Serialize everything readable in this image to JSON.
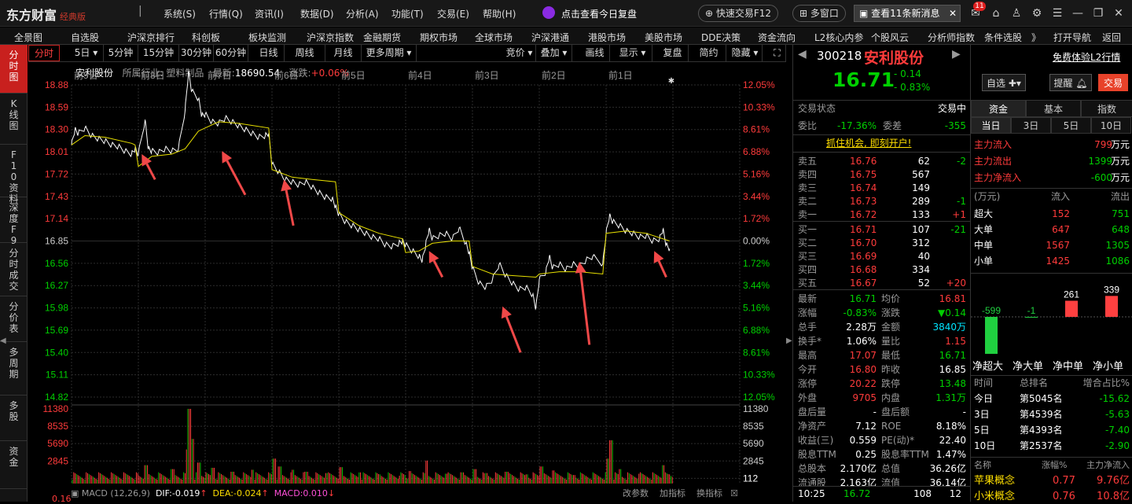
{
  "app": {
    "name": "东方财富",
    "edition": "经典版"
  },
  "top_menu": [
    "系统(S)",
    "行情(Q)",
    "资讯(I)",
    "数据(D)",
    "分析(A)",
    "功能(T)",
    "交易(E)",
    "帮助(H)"
  ],
  "top_actions": {
    "review": "点击查看今日复盘",
    "quick_trade": "快速交易F12",
    "multi_window": "多窗口",
    "messages": "查看11条新消息",
    "badge": "11"
  },
  "nav": [
    "全景图",
    "自选股",
    "沪深京排行",
    "科创板",
    "板块监测",
    "沪深京指数",
    "金融期货",
    "期权市场",
    "全球市场",
    "沪深港通",
    "港股市场",
    "美股市场",
    "DDE决策",
    "资金流向",
    "L2核心内参",
    "个股风云",
    "分析师指数",
    "条件选股",
    "》",
    "打开导航",
    "返回"
  ],
  "sidebar": [
    "分时图",
    "K线图",
    "F10资料",
    "深度F9",
    "分时成交",
    "分价表",
    "多周期",
    "多股",
    "资金"
  ],
  "toolbar": {
    "left": [
      "分时",
      "5日",
      "5分钟",
      "15分钟",
      "30分钟",
      "60分钟",
      "日线",
      "周线",
      "月线",
      "更多周期"
    ],
    "right": [
      "竞价",
      "叠加",
      "画线",
      "显示",
      "复盘",
      "简约",
      "隐藏"
    ]
  },
  "chart_header": {
    "name": "安利股份",
    "industry": "所属行业: 塑料制品",
    "latest_label": "最新:",
    "latest": "18690.54",
    "change_label": "涨跌:",
    "change": "+0.06%"
  },
  "chart_data": {
    "type": "line",
    "days": [
      "前9日",
      "前8日",
      "前7日",
      "前6日",
      "前5日",
      "前4日",
      "前3日",
      "前2日",
      "前1日",
      ""
    ],
    "price_ticks": [
      "18.88",
      "18.59",
      "18.30",
      "18.01",
      "17.72",
      "17.43",
      "17.14",
      "16.85",
      "16.56",
      "16.27",
      "15.98",
      "15.69",
      "15.40",
      "15.11",
      "14.82"
    ],
    "pct_ticks": [
      "12.05%",
      "10.33%",
      "8.61%",
      "6.88%",
      "5.16%",
      "3.44%",
      "1.72%",
      "0.00%",
      "1.72%",
      "3.44%",
      "5.16%",
      "6.88%",
      "8.61%",
      "10.33%",
      "12.05%"
    ],
    "vol_ticks": [
      "11380",
      "8535",
      "5690",
      "2845"
    ],
    "vol_right": [
      "11380",
      "8535",
      "5690",
      "2845",
      "112"
    ],
    "ylim": [
      14.82,
      18.88
    ],
    "price": [
      [
        0,
        18.1
      ],
      [
        0.05,
        18.3
      ],
      [
        0.1,
        18.25
      ],
      [
        0.2,
        18.32
      ],
      [
        0.3,
        18.22
      ],
      [
        0.4,
        18.18
      ],
      [
        0.5,
        18.15
      ],
      [
        0.6,
        18.1
      ],
      [
        0.7,
        18.08
      ],
      [
        0.8,
        18.02
      ],
      [
        0.9,
        17.98
      ],
      [
        0.95,
        18.05
      ],
      [
        1.0,
        17.98
      ],
      [
        1.1,
        18.42
      ],
      [
        1.15,
        18.05
      ],
      [
        1.2,
        18.02
      ],
      [
        1.3,
        18.0
      ],
      [
        1.4,
        18.05
      ],
      [
        1.5,
        18.02
      ],
      [
        1.6,
        18.05
      ],
      [
        1.7,
        18.55
      ],
      [
        1.75,
        19.05
      ],
      [
        1.8,
        18.8
      ],
      [
        1.9,
        18.7
      ],
      [
        1.95,
        18.48
      ],
      [
        2.0,
        18.5
      ],
      [
        2.1,
        18.4
      ],
      [
        2.2,
        18.38
      ],
      [
        2.3,
        18.45
      ],
      [
        2.4,
        18.4
      ],
      [
        2.5,
        18.35
      ],
      [
        2.6,
        18.3
      ],
      [
        2.7,
        18.25
      ],
      [
        2.8,
        18.2
      ],
      [
        2.9,
        18.22
      ],
      [
        2.95,
        18.25
      ],
      [
        3.0,
        17.85
      ],
      [
        3.1,
        17.75
      ],
      [
        3.2,
        17.65
      ],
      [
        3.3,
        17.62
      ],
      [
        3.4,
        17.58
      ],
      [
        3.5,
        17.62
      ],
      [
        3.6,
        17.55
      ],
      [
        3.7,
        17.48
      ],
      [
        3.8,
        17.42
      ],
      [
        3.9,
        17.4
      ],
      [
        3.95,
        17.3
      ],
      [
        4.0,
        17.2
      ],
      [
        4.1,
        17.1
      ],
      [
        4.2,
        17.05
      ],
      [
        4.3,
        17.0
      ],
      [
        4.4,
        16.95
      ],
      [
        4.5,
        16.9
      ],
      [
        4.6,
        16.88
      ],
      [
        4.7,
        16.8
      ],
      [
        4.8,
        16.78
      ],
      [
        4.9,
        16.82
      ],
      [
        4.95,
        16.85
      ],
      [
        5.0,
        16.8
      ],
      [
        5.1,
        16.72
      ],
      [
        5.2,
        16.65
      ],
      [
        5.25,
        16.6
      ],
      [
        5.3,
        16.8
      ],
      [
        5.35,
        17.0
      ],
      [
        5.4,
        16.88
      ],
      [
        5.5,
        16.92
      ],
      [
        5.6,
        16.95
      ],
      [
        5.7,
        16.88
      ],
      [
        5.8,
        17.02
      ],
      [
        5.9,
        16.82
      ],
      [
        5.95,
        16.7
      ],
      [
        6.0,
        16.5
      ],
      [
        6.1,
        16.3
      ],
      [
        6.2,
        16.25
      ],
      [
        6.3,
        16.35
      ],
      [
        6.4,
        16.55
      ],
      [
        6.5,
        16.4
      ],
      [
        6.6,
        16.3
      ],
      [
        6.7,
        16.22
      ],
      [
        6.8,
        16.25
      ],
      [
        6.9,
        16.15
      ],
      [
        6.95,
        15.98
      ],
      [
        7.0,
        16.35
      ],
      [
        7.1,
        16.45
      ],
      [
        7.15,
        16.65
      ],
      [
        7.2,
        16.5
      ],
      [
        7.3,
        16.55
      ],
      [
        7.4,
        16.48
      ],
      [
        7.5,
        16.55
      ],
      [
        7.6,
        16.52
      ],
      [
        7.7,
        16.6
      ],
      [
        7.8,
        16.65
      ],
      [
        7.95,
        16.55
      ],
      [
        8.0,
        16.95
      ],
      [
        8.05,
        17.18
      ],
      [
        8.1,
        17.1
      ],
      [
        8.2,
        17.05
      ],
      [
        8.3,
        16.98
      ],
      [
        8.4,
        16.95
      ],
      [
        8.5,
        16.9
      ],
      [
        8.6,
        16.92
      ],
      [
        8.7,
        16.85
      ],
      [
        8.8,
        16.88
      ],
      [
        8.85,
        17.0
      ],
      [
        8.9,
        16.8
      ],
      [
        8.95,
        16.75
      ]
    ],
    "avg": [
      [
        0,
        18.1
      ],
      [
        0.2,
        18.22
      ],
      [
        0.5,
        18.2
      ],
      [
        0.9,
        18.12
      ],
      [
        0.95,
        18.1
      ],
      [
        1.0,
        17.82
      ],
      [
        1.2,
        17.95
      ],
      [
        1.5,
        17.98
      ],
      [
        1.7,
        18.05
      ],
      [
        1.9,
        18.28
      ],
      [
        2.2,
        18.4
      ],
      [
        2.5,
        18.38
      ],
      [
        2.95,
        18.32
      ],
      [
        3.0,
        17.78
      ],
      [
        3.3,
        17.68
      ],
      [
        3.6,
        17.65
      ],
      [
        3.95,
        17.62
      ],
      [
        4.0,
        17.22
      ],
      [
        4.3,
        17.05
      ],
      [
        4.6,
        16.95
      ],
      [
        4.95,
        16.88
      ],
      [
        5.0,
        16.7
      ],
      [
        5.2,
        16.72
      ],
      [
        5.4,
        16.82
      ],
      [
        5.7,
        16.85
      ],
      [
        5.95,
        16.85
      ],
      [
        6.0,
        16.52
      ],
      [
        6.3,
        16.42
      ],
      [
        6.6,
        16.4
      ],
      [
        6.95,
        16.38
      ],
      [
        7.0,
        16.42
      ],
      [
        7.3,
        16.45
      ],
      [
        7.6,
        16.45
      ],
      [
        7.95,
        16.42
      ],
      [
        8.0,
        16.95
      ],
      [
        8.3,
        16.98
      ],
      [
        8.6,
        16.95
      ],
      [
        8.95,
        16.85
      ]
    ],
    "volume": [
      [
        0.05,
        1200
      ],
      [
        0.3,
        900
      ],
      [
        0.6,
        1100
      ],
      [
        1.1,
        2800
      ],
      [
        1.3,
        1500
      ],
      [
        1.5,
        2200
      ],
      [
        1.72,
        5200
      ],
      [
        1.75,
        11380
      ],
      [
        1.8,
        6800
      ],
      [
        1.9,
        3200
      ],
      [
        2.1,
        2400
      ],
      [
        2.4,
        1800
      ],
      [
        2.7,
        2100
      ],
      [
        3.02,
        3800
      ],
      [
        3.1,
        2600
      ],
      [
        3.3,
        2100
      ],
      [
        3.5,
        1800
      ],
      [
        3.8,
        1600
      ],
      [
        4.02,
        2500
      ],
      [
        4.3,
        1700
      ],
      [
        4.6,
        1400
      ],
      [
        4.9,
        1200
      ],
      [
        5.05,
        1900
      ],
      [
        5.3,
        3500
      ],
      [
        5.6,
        1500
      ],
      [
        5.85,
        1700
      ],
      [
        6.02,
        2200
      ],
      [
        6.2,
        1600
      ],
      [
        6.5,
        1800
      ],
      [
        6.8,
        1400
      ],
      [
        7.02,
        2600
      ],
      [
        7.2,
        2000
      ],
      [
        7.5,
        1300
      ],
      [
        7.8,
        1100
      ],
      [
        8.02,
        3800
      ],
      [
        8.06,
        6600
      ],
      [
        8.2,
        2200
      ],
      [
        8.5,
        1500
      ],
      [
        8.85,
        2800
      ],
      [
        8.92,
        1400
      ]
    ],
    "annotations": "red arrows"
  },
  "macd": {
    "name": "MACD (12,26,9)",
    "dif_label": "DIF:",
    "dif": "-0.019",
    "dea_label": "DEA:",
    "dea": "-0.024",
    "macd_label": "MACD:",
    "macd": "0.010",
    "low_tick": "0.16",
    "actions": [
      "改参数",
      "加指标",
      "换指标"
    ]
  },
  "quote": {
    "code": "300218",
    "name": "安利股份",
    "price": "16.71",
    "change": "- 0.14",
    "change_pct": "- 0.83%",
    "l2_link": "免费体验L2行情",
    "btn_watch": "自选",
    "btn_alert": "提醒",
    "btn_trade": "交易",
    "trade_status_label": "交易状态",
    "trade_status": "交易中",
    "weibi_label": "委比",
    "weibi": "-17.36%",
    "weicha_label": "委差",
    "weicha": "-355",
    "promo": "抓住机会, 即刻开户!",
    "sells": [
      [
        "卖五",
        "16.76",
        "62",
        "-2"
      ],
      [
        "卖四",
        "16.75",
        "567",
        ""
      ],
      [
        "卖三",
        "16.74",
        "149",
        ""
      ],
      [
        "卖二",
        "16.73",
        "289",
        "-1"
      ],
      [
        "卖一",
        "16.72",
        "133",
        "+1"
      ]
    ],
    "buys": [
      [
        "买一",
        "16.71",
        "107",
        "-21"
      ],
      [
        "买二",
        "16.70",
        "312",
        ""
      ],
      [
        "买三",
        "16.69",
        "40",
        ""
      ],
      [
        "买四",
        "16.68",
        "334",
        ""
      ],
      [
        "买五",
        "16.67",
        "52",
        "+20"
      ]
    ],
    "stats": [
      [
        "最新",
        "16.71",
        "均价",
        "16.81"
      ],
      [
        "涨幅",
        "-0.83%",
        "涨跌",
        "▼0.14"
      ],
      [
        "总手",
        "2.28万",
        "金额",
        "3840万"
      ],
      [
        "换手*",
        "1.06%",
        "量比",
        "1.15"
      ],
      [
        "最高",
        "17.07",
        "最低",
        "16.71"
      ],
      [
        "今开",
        "16.80",
        "昨收",
        "16.85"
      ],
      [
        "涨停",
        "20.22",
        "跌停",
        "13.48"
      ],
      [
        "外盘",
        "9705",
        "内盘",
        "1.31万"
      ],
      [
        "盘后量",
        "-",
        "盘后额",
        "-"
      ],
      [
        "净资产",
        "7.12",
        "ROE",
        "8.18%"
      ],
      [
        "收益(三)",
        "0.559",
        "PE(动)*",
        "22.40"
      ],
      [
        "股息TTM",
        "0.25",
        "股息率TTM",
        "1.47%"
      ],
      [
        "总股本",
        "2.170亿",
        "总值",
        "36.26亿"
      ],
      [
        "流通股",
        "2.163亿",
        "流值",
        "36.14亿"
      ]
    ],
    "tick": {
      "time": "10:25",
      "price": "16.72",
      "vol": "108",
      "num": "12"
    }
  },
  "funds": {
    "tabs": [
      "资金",
      "基本",
      "指数"
    ],
    "periods": [
      "当日",
      "3日",
      "5日",
      "10日"
    ],
    "main_in_label": "主力流入",
    "main_in": "799",
    "main_out_label": "主力流出",
    "main_out": "1399",
    "main_net_label": "主力净流入",
    "main_net": "-600",
    "unit": "万元",
    "table_head": [
      "(万元)",
      "流入",
      "流出"
    ],
    "rows": [
      [
        "超大",
        "152",
        "751"
      ],
      [
        "大单",
        "647",
        "648"
      ],
      [
        "中单",
        "1567",
        "1305"
      ],
      [
        "小单",
        "1425",
        "1086"
      ]
    ],
    "bars": [
      {
        "label": "净超大",
        "value": -599
      },
      {
        "label": "净大单",
        "value": -1
      },
      {
        "label": "净中单",
        "value": 261
      },
      {
        "label": "净小单",
        "value": 339
      }
    ],
    "rank_head": [
      "时间",
      "总排名",
      "增合占比%"
    ],
    "ranks": [
      [
        "今日",
        "第5045名",
        "-15.62"
      ],
      [
        "3日",
        "第4539名",
        "-5.63"
      ],
      [
        "5日",
        "第4393名",
        "-7.40"
      ],
      [
        "10日",
        "第2537名",
        "-2.90"
      ]
    ],
    "sector_head": [
      "名称",
      "涨幅%",
      "主力净流入"
    ],
    "sectors": [
      [
        "苹果概念",
        "0.77",
        "9.76亿"
      ],
      [
        "小米概念",
        "0.76",
        "10.8亿"
      ]
    ]
  }
}
